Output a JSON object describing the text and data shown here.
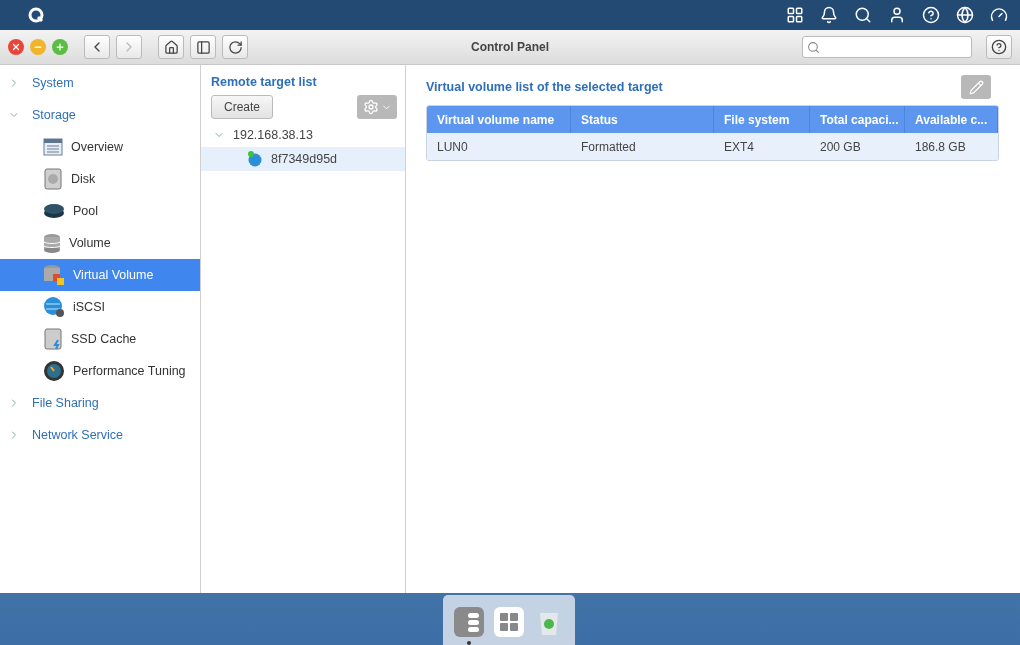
{
  "window": {
    "title": "Control Panel"
  },
  "sidebar": {
    "items": [
      {
        "label": "System",
        "expanded": false,
        "selected": false
      },
      {
        "label": "Storage",
        "expanded": true,
        "selected": false,
        "children": [
          {
            "label": "Overview",
            "selected": false
          },
          {
            "label": "Disk",
            "selected": false
          },
          {
            "label": "Pool",
            "selected": false
          },
          {
            "label": "Volume",
            "selected": false
          },
          {
            "label": "Virtual Volume",
            "selected": true
          },
          {
            "label": "iSCSI",
            "selected": false
          },
          {
            "label": "SSD Cache",
            "selected": false
          },
          {
            "label": "Performance Tuning",
            "selected": false
          }
        ]
      },
      {
        "label": "File Sharing",
        "expanded": false,
        "selected": false
      },
      {
        "label": "Network Service",
        "expanded": false,
        "selected": false
      }
    ]
  },
  "targets": {
    "title": "Remote target list",
    "create": "Create",
    "tree": [
      {
        "label": "192.168.38.13",
        "expanded": true,
        "selected": false,
        "children": [
          {
            "label": "8f7349d95d",
            "selected": true
          }
        ]
      }
    ]
  },
  "volumes": {
    "title": "Virtual volume list of the selected target",
    "columns": [
      "Virtual volume name",
      "Status",
      "File system",
      "Total capaci...",
      "Available c..."
    ],
    "rows": [
      {
        "cells": [
          "LUN0",
          "Formatted",
          "EXT4",
          "200 GB",
          "186.8 GB"
        ],
        "selected": true
      }
    ]
  },
  "dock": [
    {
      "active": true
    },
    {
      "active": false
    },
    {
      "active": false
    }
  ]
}
